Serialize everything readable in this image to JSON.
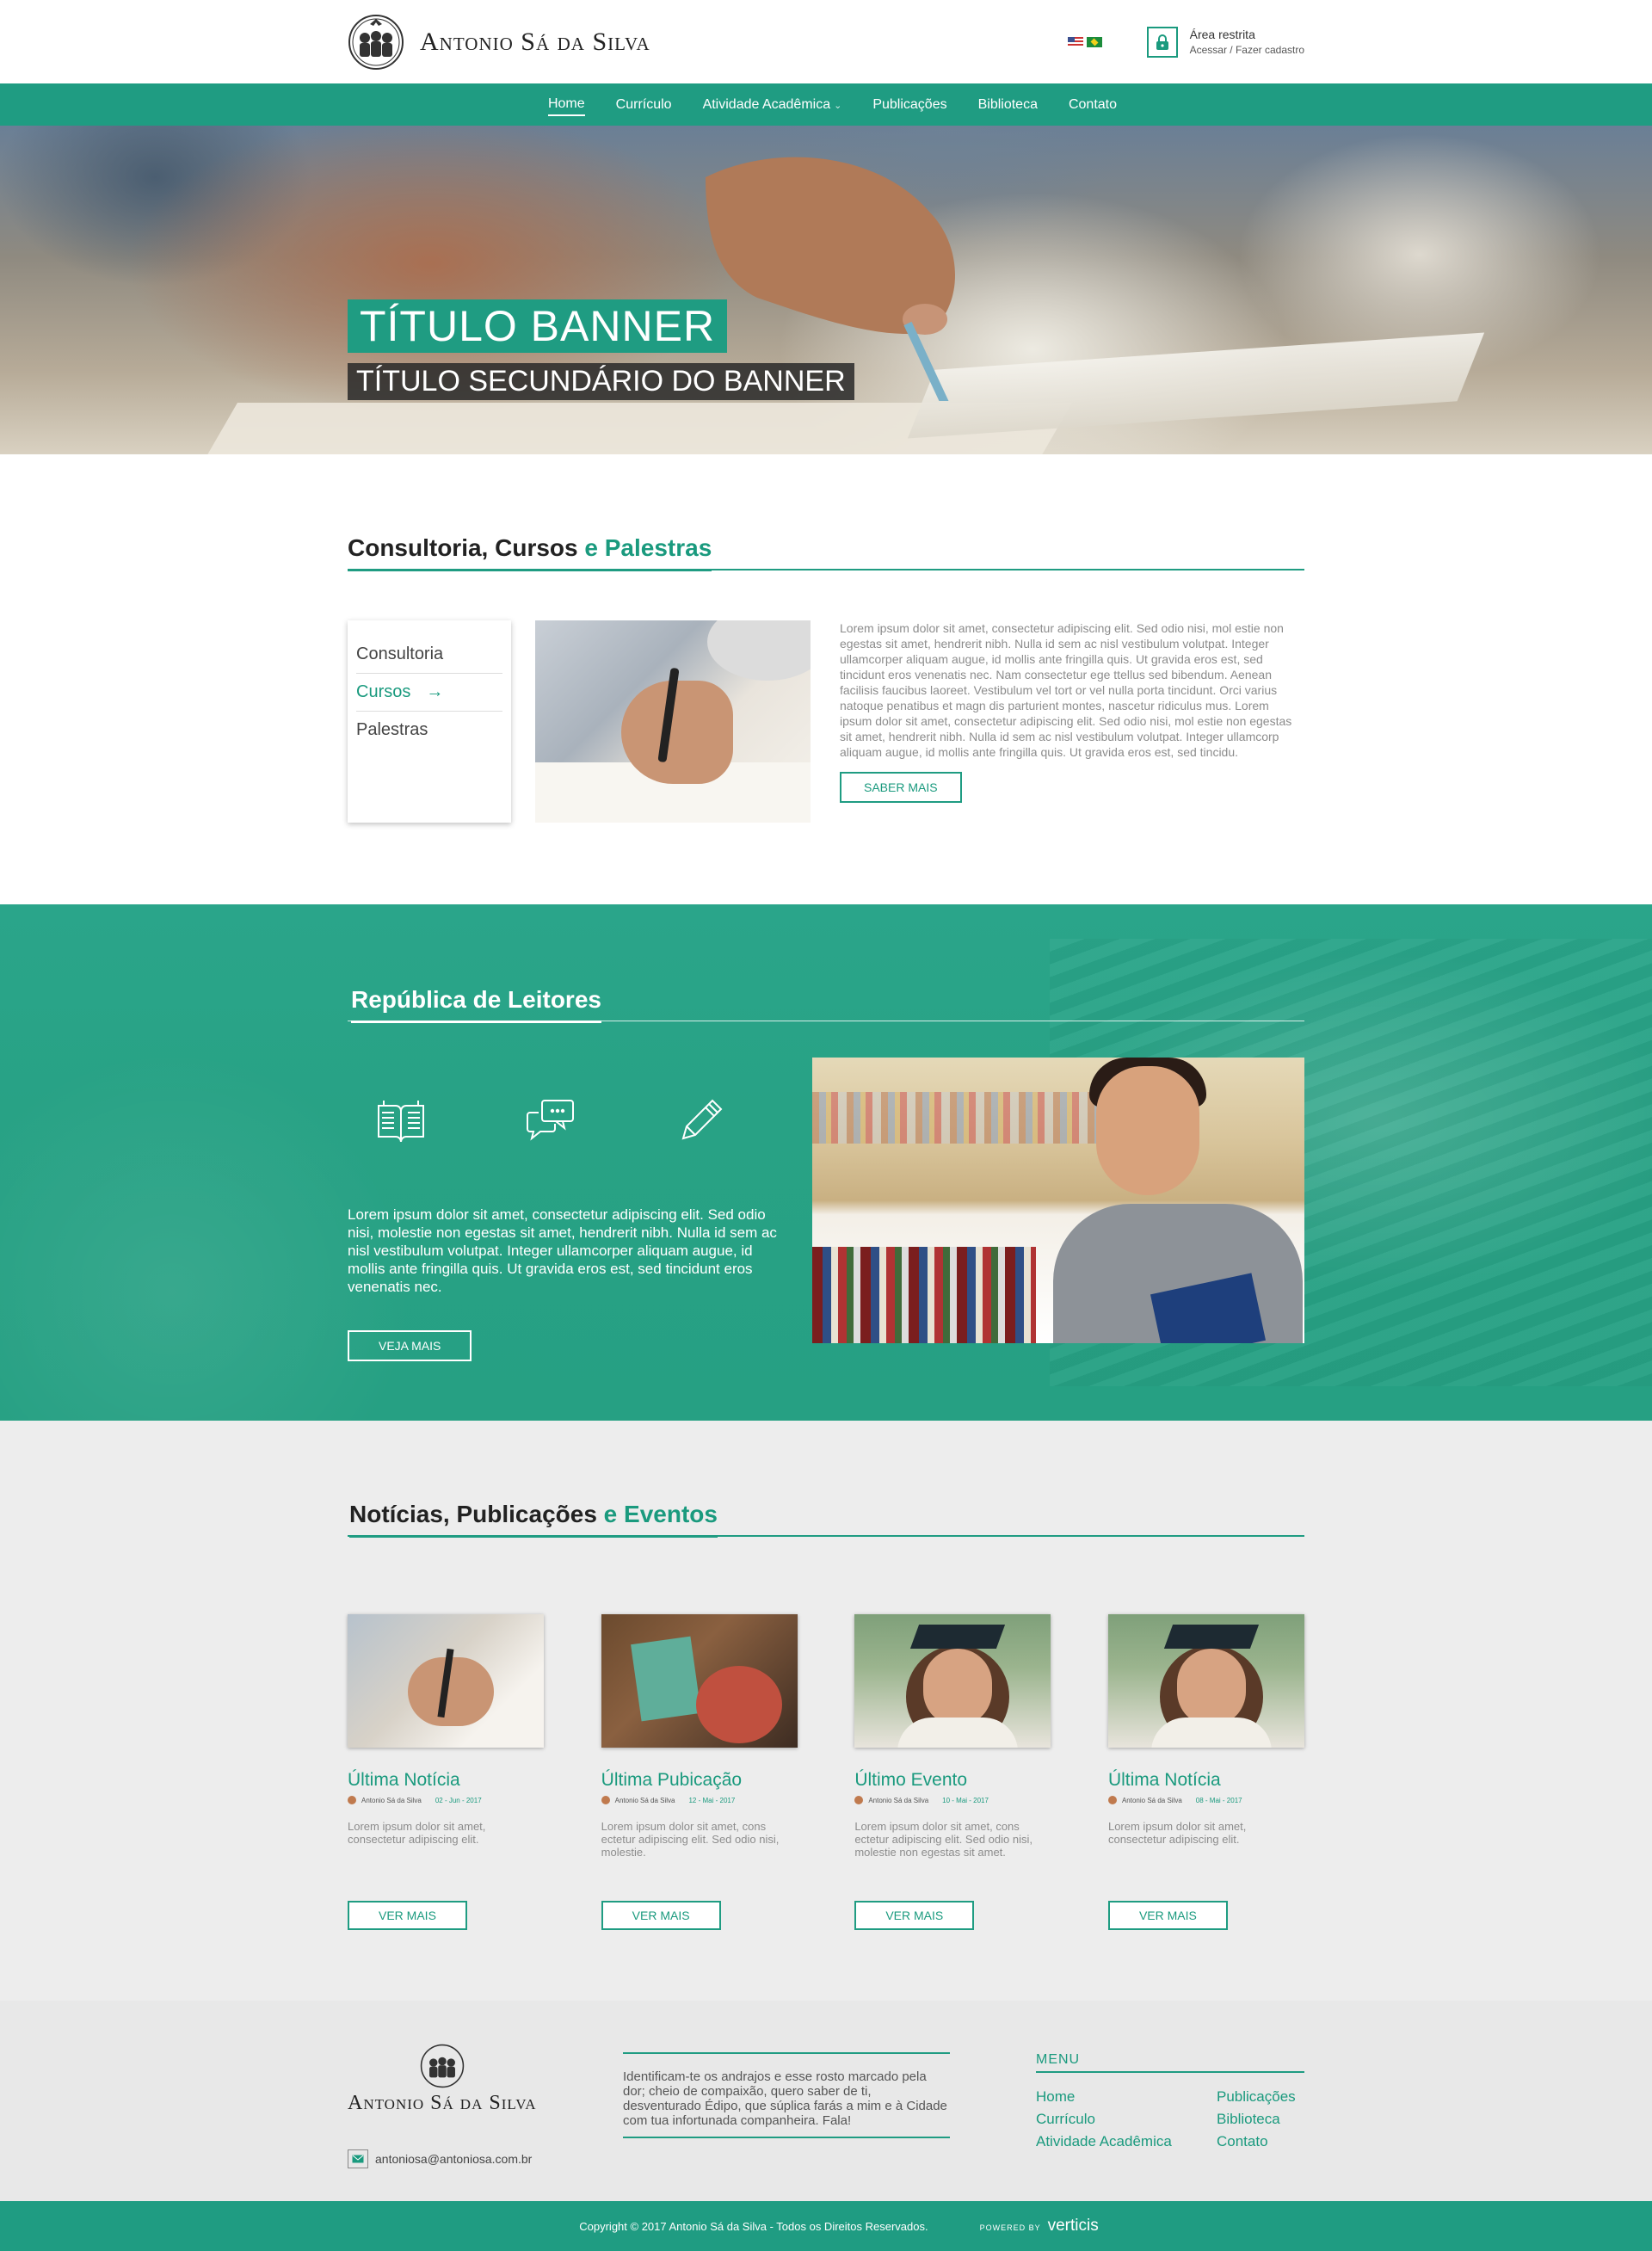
{
  "brand": {
    "name": "Antonio Sá da Silva"
  },
  "header": {
    "restricted_title": "Área restrita",
    "restricted_sub": "Acessar / Fazer cadastro"
  },
  "nav": {
    "items": [
      {
        "label": "Home"
      },
      {
        "label": "Currículo"
      },
      {
        "label": "Atividade Acadêmica"
      },
      {
        "label": "Publicações"
      },
      {
        "label": "Biblioteca"
      },
      {
        "label": "Contato"
      }
    ],
    "active": "Home"
  },
  "hero": {
    "title": "TÍTULO BANNER",
    "subtitle": "TÍTULO SECUNDÁRIO DO BANNER"
  },
  "consult": {
    "title_main": "Consultoria, Cursos",
    "title_accent": "e Palestras",
    "tabs": [
      {
        "label": "Consultoria"
      },
      {
        "label": "Cursos"
      },
      {
        "label": "Palestras"
      }
    ],
    "active_tab": "Cursos",
    "text": "Lorem ipsum dolor sit amet, consectetur adipiscing elit. Sed odio nisi, mol estie non egestas sit amet, hendrerit nibh. Nulla id sem ac nisl vestibulum volutpat. Integer ullamcorper aliquam augue, id mollis ante fringilla quis. Ut gravida eros est, sed tincidunt eros venenatis nec. Nam consectetur ege ttellus sed bibendum. Aenean facilisis faucibus laoreet. Vestibulum vel tort or vel nulla porta tincidunt. Orci varius natoque penatibus et magn dis parturient montes, nascetur ridiculus mus. Lorem ipsum dolor sit amet, consectetur adipiscing elit. Sed odio nisi, mol estie non egestas sit amet, hendrerit nibh. Nulla id sem ac nisl vestibulum volutpat. Integer ullamcorp aliquam augue, id mollis ante fringilla quis. Ut gravida eros est, sed tincidu.",
    "button": "SABER MAIS"
  },
  "republica": {
    "title": "República de Leitores",
    "text": "Lorem ipsum dolor sit amet, consectetur adipiscing elit. Sed odio nisi, molestie non egestas sit amet, hendrerit nibh. Nulla id sem ac nisl vestibulum volutpat. Integer ullamcorper aliquam augue, id mollis ante fringilla quis. Ut gravida eros est, sed tincidunt eros venenatis nec.",
    "button": "VEJA MAIS",
    "icons": [
      "book-icon",
      "chat-icon",
      "pencil-icon"
    ]
  },
  "news": {
    "title_main": "Notícias, Publicações",
    "title_accent": "e Eventos",
    "cards": [
      {
        "title": "Última Notícia",
        "author": "Antonio Sá da Silva",
        "date": "02 - Jun - 2017",
        "text": "Lorem ipsum dolor sit amet, consectetur adipiscing elit.",
        "button": "VER MAIS"
      },
      {
        "title": "Última Pubicação",
        "author": "Antonio Sá da Silva",
        "date": "12 - Mai - 2017",
        "text": "Lorem ipsum dolor sit amet, cons ectetur adipiscing elit. Sed odio nisi, molestie.",
        "button": "VER MAIS"
      },
      {
        "title": "Último Evento",
        "author": "Antonio Sá da Silva",
        "date": "10 - Mai - 2017",
        "text": "Lorem ipsum dolor sit amet, cons ectetur adipiscing elit. Sed odio nisi, molestie non egestas sit amet.",
        "button": "VER MAIS"
      },
      {
        "title": "Última Notícia",
        "author": "Antonio Sá da Silva",
        "date": "08 - Mai - 2017",
        "text": "Lorem ipsum dolor sit amet, consectetur adipiscing elit.",
        "button": "VER MAIS"
      }
    ]
  },
  "footer": {
    "email": "antoniosa@antoniosa.com.br",
    "quote": "Identificam-te os andrajos e esse rosto  marcado pela dor; cheio de compaixão,  quero saber de ti, desventurado Édipo,  que súplica farás a mim e à Cidade com tua infortunada companheira. Fala!",
    "menu_title": "MENU",
    "menu": [
      "Home",
      "Publicações",
      "Currículo",
      "Biblioteca",
      "Atividade Acadêmica",
      "Contato"
    ],
    "copyright": "Copyright © 2017 Antonio Sá da Silva - Todos os Direitos Reservados.",
    "powered_by": "POWERED BY",
    "powered_brand": "verticis"
  },
  "colors": {
    "accent": "#1f9c82",
    "accent_text": "#1a9a7e",
    "footer_bg": "#e8e8e8",
    "news_bg": "#ededed"
  }
}
